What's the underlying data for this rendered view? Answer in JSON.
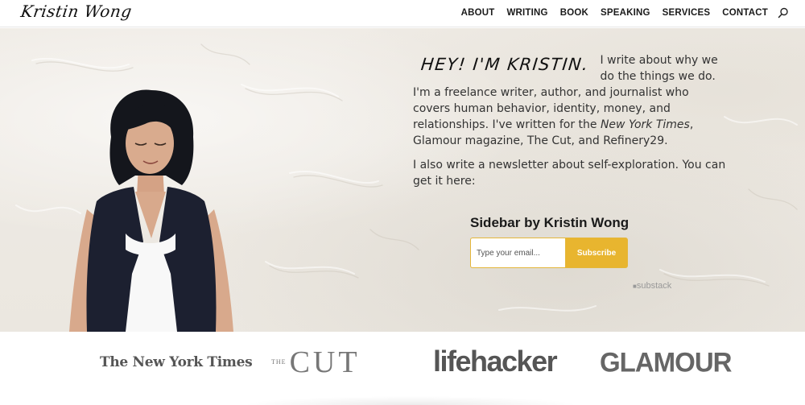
{
  "header": {
    "logo_text": "Kristin Wong",
    "nav": [
      "ABOUT",
      "WRITING",
      "BOOK",
      "SPEAKING",
      "SERVICES",
      "CONTACT"
    ],
    "search_icon": "search-icon"
  },
  "intro": {
    "greeting": "HEY! I'M KRISTIN.",
    "p1_part1": "I write about why we do the things we do. I'm a freelance writer, author, and journalist who covers human behavior, identity, money, and relationships. I've written for the ",
    "p1_em": "New York Times",
    "p1_part2": ", Glamour magazine, The Cut, and Refinery29.",
    "p2": "I also write a newsletter about self-exploration. You can get it here:"
  },
  "newsletter": {
    "title": "Sidebar by Kristin Wong",
    "email_placeholder": "Type your email...",
    "subscribe_label": "Subscribe",
    "brand": "substack"
  },
  "press": {
    "nyt": "The New York Times",
    "cut_the": "THE",
    "cut_main": "CUT",
    "lifehacker": "lifehacker",
    "glamour": "GLAMOUR"
  },
  "colors": {
    "accent": "#e8b52f",
    "text": "#333333",
    "wall": "#ece8e1"
  }
}
